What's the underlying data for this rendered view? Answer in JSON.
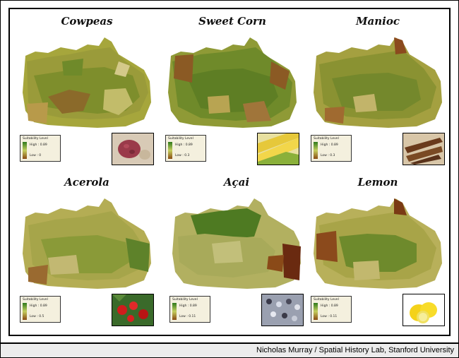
{
  "panels": [
    {
      "title": "Cowpeas",
      "legend_title": "Suitability Level",
      "legend_high": "High : 0.89",
      "legend_low": "Low : 0",
      "photo_icon": "cowpeas-photo"
    },
    {
      "title": "Sweet Corn",
      "legend_title": "Suitability Level",
      "legend_high": "High : 0.89",
      "legend_low": "Low : 0.3",
      "photo_icon": "sweet-corn-photo"
    },
    {
      "title": "Manioc",
      "legend_title": "Suitability Level",
      "legend_high": "High : 0.89",
      "legend_low": "Low : 0.3",
      "photo_icon": "manioc-photo"
    },
    {
      "title": "Acerola",
      "legend_title": "Suitability Level",
      "legend_high": "High : 0.89",
      "legend_low": "Low : 0.5",
      "photo_icon": "acerola-photo"
    },
    {
      "title": "Açai",
      "legend_title": "Suitability Level",
      "legend_high": "High : 0.89",
      "legend_low": "Low : 0.11",
      "photo_icon": "acai-photo"
    },
    {
      "title": "Lemon",
      "legend_title": "Suitability Level",
      "legend_high": "High : 0.89",
      "legend_low": "Low : 0.11",
      "photo_icon": "lemon-photo"
    }
  ],
  "credit": "Nicholas Murray / Spatial History Lab, Stanford University"
}
